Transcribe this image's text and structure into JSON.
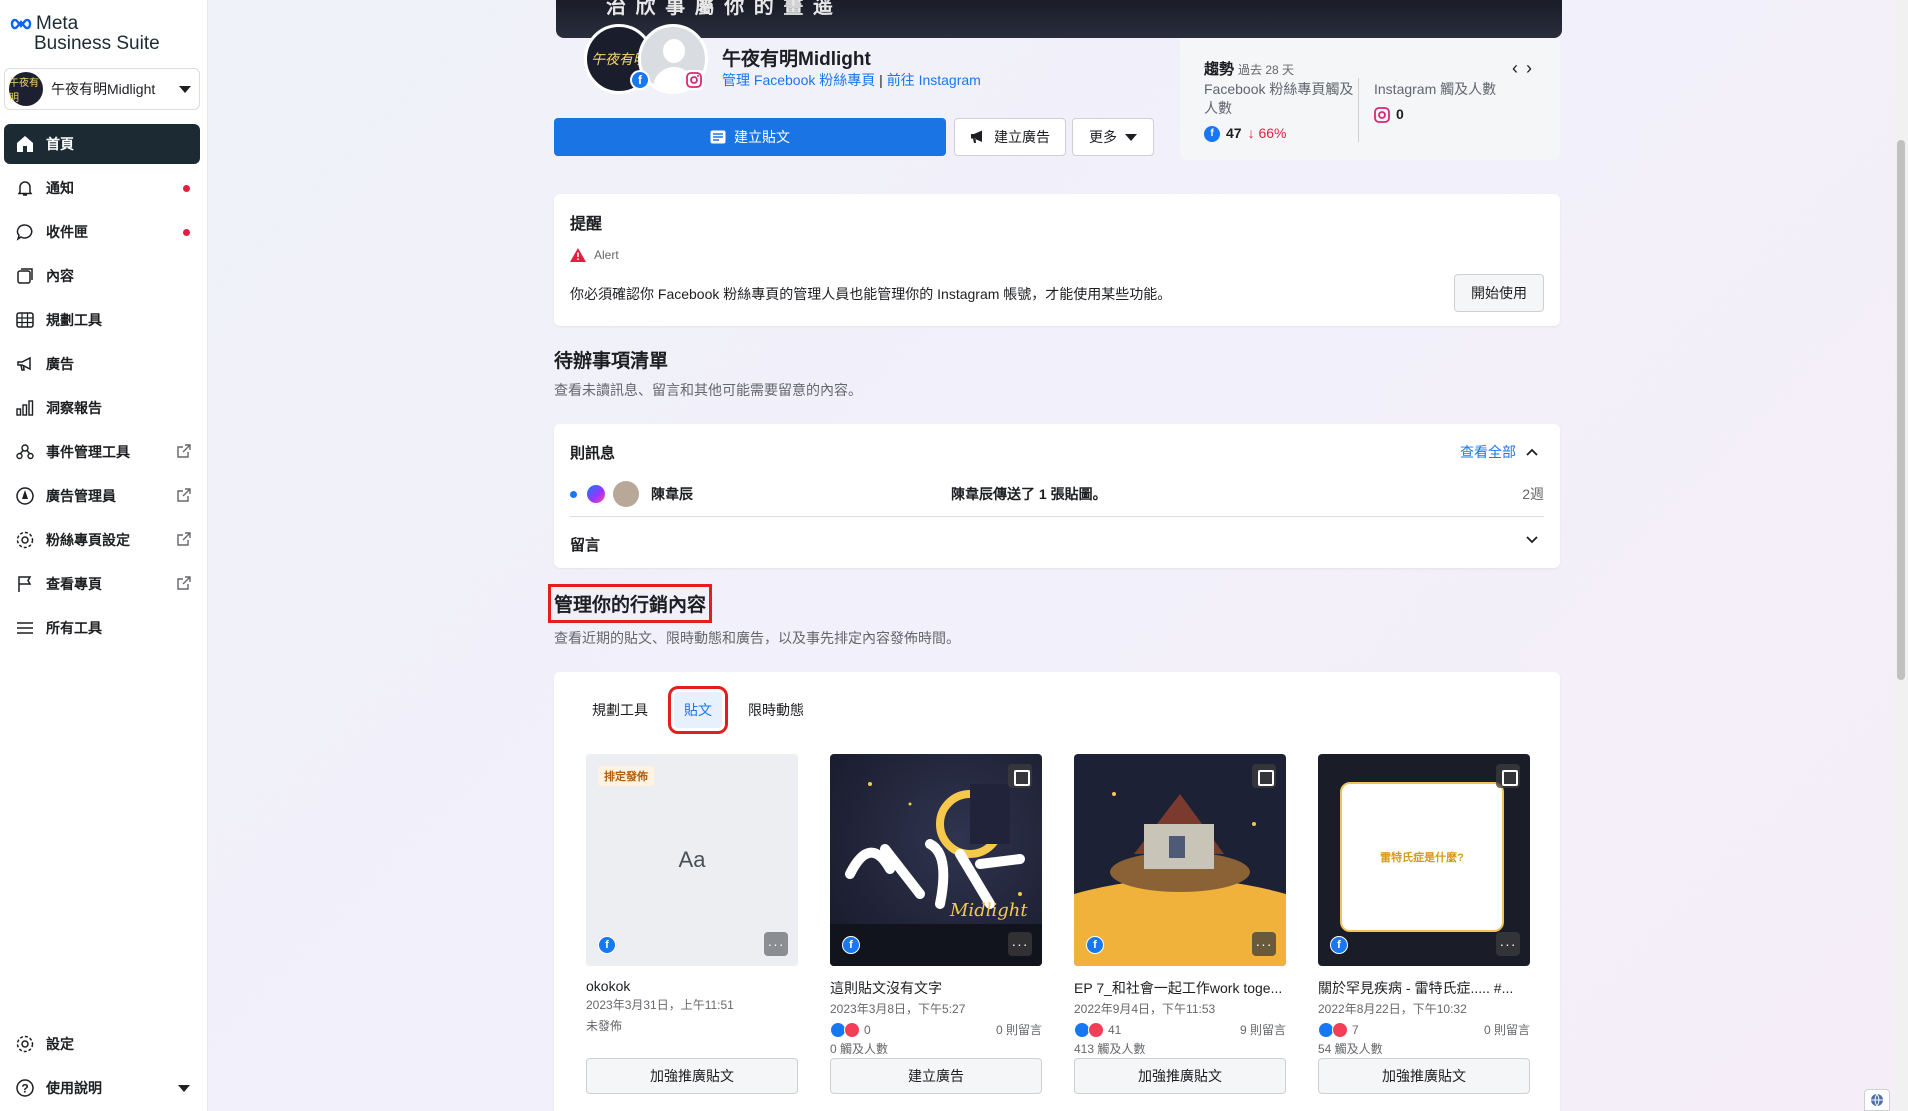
{
  "brand": {
    "meta": "Meta",
    "suite": "Business Suite"
  },
  "account": {
    "name": "午夜有明Midlight",
    "avatar_text": "午夜有明"
  },
  "sidebar": {
    "items": [
      {
        "label": "首頁",
        "icon": "home-icon",
        "active": true
      },
      {
        "label": "通知",
        "icon": "bell-icon",
        "dot": true
      },
      {
        "label": "收件匣",
        "icon": "chat-bubble-icon",
        "dot": true
      },
      {
        "label": "內容",
        "icon": "content-icon"
      },
      {
        "label": "規劃工具",
        "icon": "calendar-grid-icon"
      },
      {
        "label": "廣告",
        "icon": "megaphone-icon"
      },
      {
        "label": "洞察報告",
        "icon": "bar-chart-icon"
      },
      {
        "label": "事件管理工具",
        "icon": "people-network-icon",
        "external": true
      },
      {
        "label": "廣告管理員",
        "icon": "compass-icon",
        "external": true
      },
      {
        "label": "粉絲專頁設定",
        "icon": "gear-icon",
        "external": true
      },
      {
        "label": "查看專頁",
        "icon": "flag-icon",
        "external": true
      },
      {
        "label": "所有工具",
        "icon": "menu-icon"
      }
    ],
    "bottom": [
      {
        "label": "設定",
        "icon": "gear-icon"
      },
      {
        "label": "使用說明",
        "icon": "help-icon"
      }
    ]
  },
  "header": {
    "cover_text": "治 欣 事 屬 你 的 畫 遥",
    "page_name": "午夜有明Midlight",
    "manage_link": "管理 Facebook 粉絲專頁",
    "separator": "|",
    "instagram_link": "前往 Instagram",
    "create_post": "建立貼文",
    "create_ad": "建立廣告",
    "more": "更多"
  },
  "trend": {
    "title": "趨勢",
    "period": "過去 28 天",
    "fb_label": "Facebook 粉絲專頁觸及人數",
    "fb_value": "47",
    "fb_change": "↓ 66%",
    "ig_label": "Instagram 觸及人數",
    "ig_value": "0"
  },
  "alert": {
    "title": "提醒",
    "tag": "Alert",
    "text": "你必須確認你 Facebook 粉絲專頁的管理人員也能管理你的 Instagram 帳號，才能使用某些功能。",
    "button": "開始使用"
  },
  "todo": {
    "heading": "待辦事項清單",
    "sub": "查看未讀訊息、留言和其他可能需要留意的內容。",
    "messages_title": "則訊息",
    "view_all": "查看全部",
    "message": {
      "sender": "陳韋辰",
      "snippet": "陳韋辰傳送了 1 張貼圖。",
      "time": "2週"
    },
    "comments_title": "留言"
  },
  "marketing": {
    "heading": "管理你的行銷內容",
    "sub": "查看近期的貼文、限時動態和廣告，以及事先排定內容發佈時間。",
    "tabs": [
      "規劃工具",
      "貼文",
      "限時動態"
    ],
    "posts": [
      {
        "badge": "排定發佈",
        "placeholder": "Aa",
        "title": "okokok",
        "date": "2023年3月31日，上午11:51",
        "status": "未發佈",
        "button": "加強推廣貼文"
      },
      {
        "title": "這則貼文沒有文字",
        "date": "2023年3月8日，下午5:27",
        "reactions": "0",
        "comments": "0 則留言",
        "reach": "0 觸及人數",
        "button": "建立廣告"
      },
      {
        "title": "EP 7_和社會一起工作work toge...",
        "date": "2022年9月4日，下午11:53",
        "reactions": "41",
        "comments": "9 則留言",
        "reach": "413 觸及人數",
        "button": "加強推廣貼文"
      },
      {
        "title": "關於罕見疾病 - 雷特氏症..... #...",
        "date": "2022年8月22日，下午10:32",
        "reactions": "7",
        "comments": "0 則留言",
        "reach": "54 觸及人數",
        "button": "加強推廣貼文",
        "image_text": "雷特氏症是什麼?"
      }
    ]
  },
  "colors": {
    "accent": "#1b74e4",
    "active_nav": "#1c2b33",
    "highlight": "#e41e1e",
    "alert": "#e41e3f"
  }
}
